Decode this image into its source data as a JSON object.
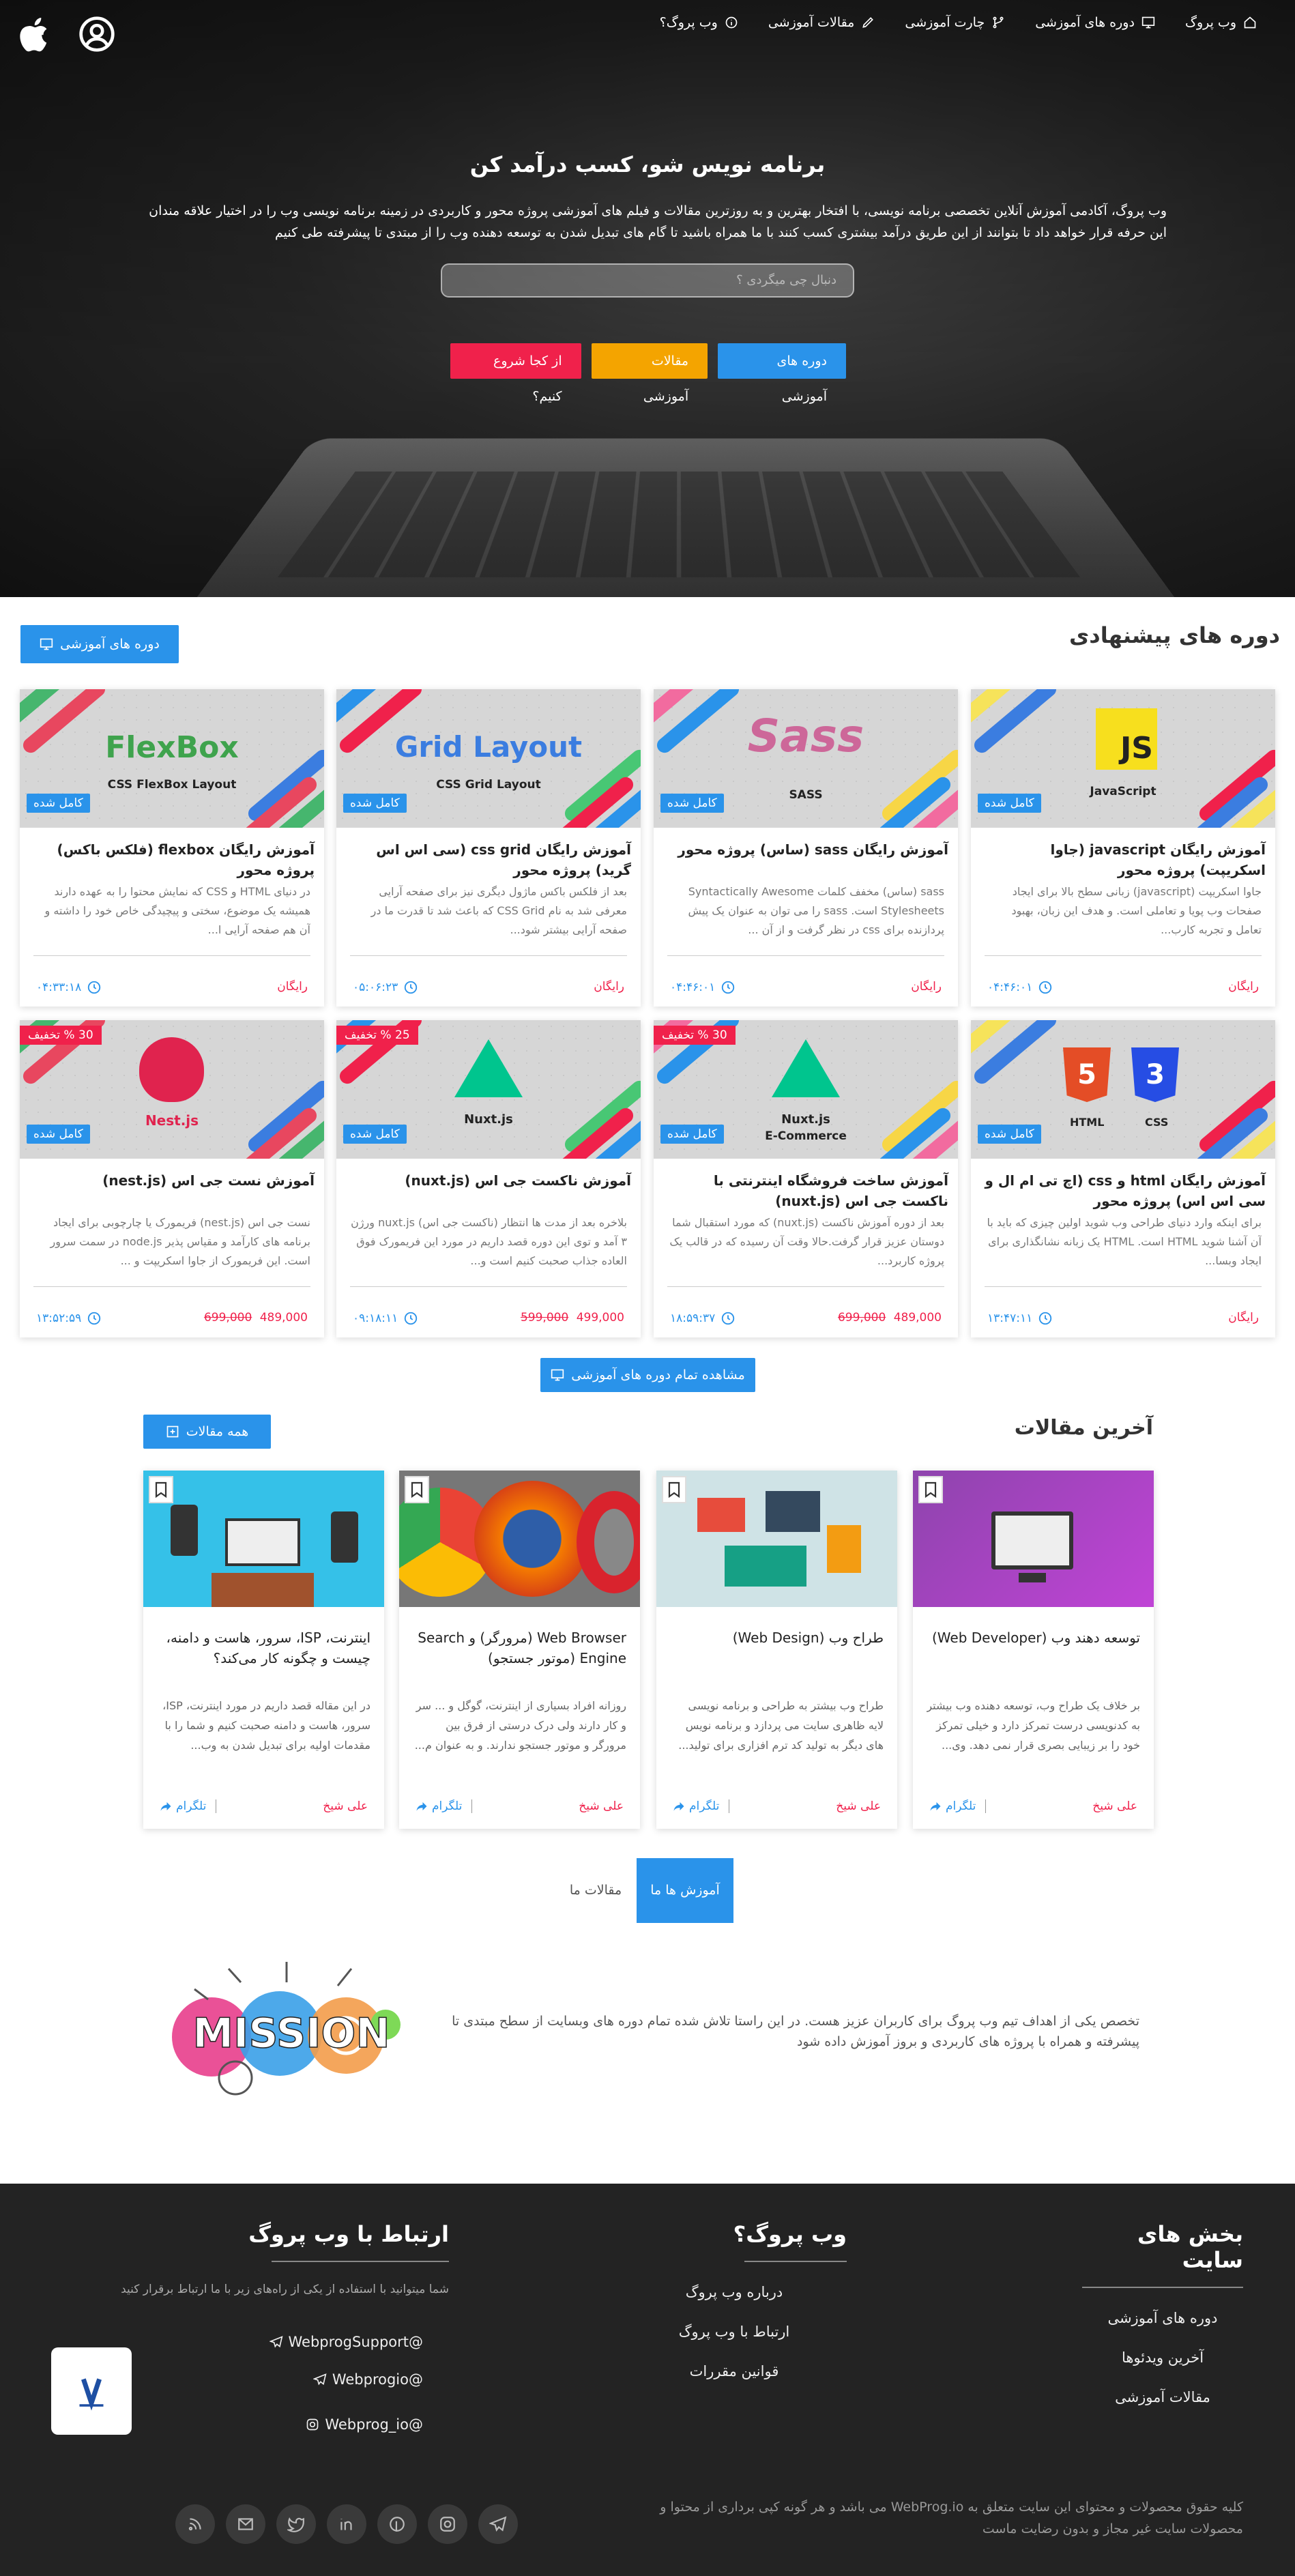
{
  "nav": {
    "items": [
      {
        "label": "وب پروگ",
        "icon": "home-icon"
      },
      {
        "label": "دوره های آموزشی",
        "icon": "monitor-icon"
      },
      {
        "label": "چارت آموزشی",
        "icon": "branch-icon"
      },
      {
        "label": "مقالات آموزشی",
        "icon": "pen-icon"
      },
      {
        "label": "وب پروگ؟",
        "icon": "info-icon"
      }
    ]
  },
  "hero": {
    "title": "برنامه نویس شو، کسب درآمد کن",
    "desc": "وب پروگ، آکادمی آموزش آنلاین تخصصی برنامه نویسی، با افتخار بهترین و به روزترین مقالات و فیلم های آموزشی پروژه محور و کاربردی در زمینه برنامه نویسی وب را در اختیار علاقه مندان این حرفه قرار خواهد داد تا بتوانند از این طریق درآمد بیشتری کسب کنند با ما همراه باشید تا گام های تبدیل شدن به توسعه دهنده وب را از مبتدی تا پیشرفته طی کنیم",
    "search_placeholder": "دنبال چی میگردی ؟",
    "btn_courses": "دوره های آموزشی",
    "btn_articles": "مقالات آموزشی",
    "btn_start": "از کجا شروع کنیم؟"
  },
  "courses": {
    "title": "دوره های پیشنهادی",
    "btn": "دوره های آموزشی",
    "done_label": "کامل شده",
    "free_label": "رایگان",
    "all_btn": "مشاهده تمام دوره های آموزشی",
    "items": [
      {
        "title": "آموزش رایگان javascript (جاوا اسکریپت) پروژه محور",
        "text": "جاوا اسکریپت (javascript) زبانی سطح بالا برای ایجاد صفحات وب پویا و تعاملی است. و هدف این زبان، بهبود تعامل و تجربه کارب...",
        "time": "۰۴:۴۶:۰۱",
        "logo": "JS",
        "sub": "JavaScript",
        "price": "رایگان",
        "old": "",
        "off": ""
      },
      {
        "title": "آموزش رایگان sass (ساس) پروژه محور",
        "text": "sass (ساس) مخفف کلمات Syntactically Awesome Stylesheets است. sass را می توان به عنوان یک پیش پردازنده برای css در نظر گرفت و از آن ...",
        "time": "۰۴:۴۶:۰۱",
        "logo": "Sass",
        "sub": "SASS",
        "price": "رایگان",
        "old": "",
        "off": ""
      },
      {
        "title": "آموزش رایگان css grid (سی اس اس گرید) پروژه محور",
        "text": "بعد از فلکس باکس ماژول دیگری نیز برای صفحه آرایی معرفی شد به نام CSS Grid که باعث شد تا قدرت ما در صفحه آرایی بیشتر شود...",
        "time": "۰۵:۰۶:۲۳",
        "logo": "Grid Layout",
        "sub": "CSS Grid Layout",
        "price": "رایگان",
        "old": "",
        "off": ""
      },
      {
        "title": "آموزش رایگان flexbox (فلکس باکس) پروژه محور",
        "text": "در دنیای HTML و CSS که نمایش محتوا را به عهده دارند همیشه یک موضوع، سختی و پیچیدگی خاص خود را داشته و آن هم صفحه آرایی ا...",
        "time": "۰۴:۳۳:۱۸",
        "logo": "FlexBox",
        "sub": "CSS FlexBox Layout",
        "price": "رایگان",
        "old": "",
        "off": ""
      },
      {
        "title": "آموزش رایگان html و css (اچ تی ام ال و سی اس اس) پروژه محور",
        "text": "برای اینکه وارد دنیای طراحی وب شوید اولین چیزی که باید با آن آشنا شوید HTML است. HTML یک زبانه نشانگذاری برای ایجاد وبسا...",
        "time": "۱۳:۴۷:۱۱",
        "logo": "HTML CSS",
        "sub": "",
        "price": "رایگان",
        "old": "",
        "off": ""
      },
      {
        "title": "آموزش ساخت فروشگاه اینترنتی با ناکست جی اس (nuxt.js)",
        "text": "بعد از دوره آموزش ناکست (nuxt.js) که مورد استقبال شما دوستان عزیز قرار گرفت.حالا وقت آن رسیده که در قالب یک پروژه کاربرد...",
        "time": "۱۸:۵۹:۳۷",
        "logo": "Nuxt.js",
        "sub": "E-Commerce",
        "price": "489,000",
        "old": "699,000",
        "off": "30 % تخفیف"
      },
      {
        "title": "آموزش ناکست جی اس (nuxt.js)",
        "text": "بلاخره بعد از مدت ها انتظار (ناکست جی اس) nuxt.js ورژن ۳ آمد و توی این دوره قصد داریم در مورد این فریمورک فوق العاده جذاب صحبت کنیم است و...",
        "time": "۰۹:۱۸:۱۱",
        "logo": "Nuxt.js",
        "sub": "",
        "price": "499,000",
        "old": "599,000",
        "off": "25 % تخفیف"
      },
      {
        "title": "آموزش نست جی اس (nest.js)",
        "text": "نست جی اس (nest.js) فریمورک یا چارچوبی برای ایجاد برنامه های کارآمد و مقیاس پذیر node.js در سمت سرور است. این فریمورک از جاوا اسکریپت و ...",
        "time": "۱۳:۵۲:۵۹",
        "logo": "Nest.js",
        "sub": "",
        "price": "489,000",
        "old": "699,000",
        "off": "30 % تخفیف"
      }
    ]
  },
  "articles": {
    "title": "آخرین مقالات",
    "btn": "همه مقالات",
    "telegram": "تلگرام",
    "items": [
      {
        "title": "توسعه دهند وب (Web Developer)",
        "text": "بر خلاف یک طراح وب، توسعه دهنده وب بیشتر به کدنویسی درست تمرکز دارد و خیلی تمرکز خود را بر زیبایی بصری قرار نمی دهد. وی...",
        "author": "علی شیخ"
      },
      {
        "title": "طراح وب (Web Design)",
        "text": "طراح وب بیشتر به طراحی و برنامه نویسی لایه ظاهری سایت می پردازد و برنامه نویس های دیگر به تولید کد ترم افزاری برای تولید...",
        "author": "علی شیخ"
      },
      {
        "title": "Web Browser (مرورگر) و Search Engine (موتور جستجو)",
        "text": "روزانه افراد بسیاری از اینترنت، گوگل و ... سر و کار دارند ولی درک درستی از فرق بین مرورگر و موتور جستجو ندارند. و به عنوان م...",
        "author": "علی شیخ"
      },
      {
        "title": "اینترنت، ISP، سرور، هاست و دامنه، چیست و چگونه کار می‌کند؟",
        "text": "در این مقاله قصد داریم در مورد اینترنت، ISP، سرور، هاست و دامنه صحبت کنیم و شما را با مقدمات اولیه برای تبدیل شدن به وب...",
        "author": "علی شیخ"
      }
    ]
  },
  "tabs": {
    "active": "آموزش ها ما",
    "other": "مقالات ما"
  },
  "mission": {
    "word": "MISSION",
    "text": "تخصص یکی از اهداف تیم وب پروگ برای کاربران عزیز هست. در این راستا تلاش شده تمام دوره های وبسایت از سطح مبتدی تا پیشرفته و همراه با پروژه های کاربردی و بروز آموزش داده شود"
  },
  "footer": {
    "col1": {
      "title": "بخش های سایت",
      "links": [
        "دوره های آموزشی",
        "آخرین ویدئوها",
        "مقالات آموزشی"
      ]
    },
    "col2": {
      "title": "وب پروگ؟",
      "links": [
        "درباره وب پروگ",
        "ارتباط با وب پروگ",
        "قوانین مقررات"
      ]
    },
    "col3": {
      "title": "ارتباط با وب پروگ",
      "desc": "شما میتوانید با استفاده از یکی از راه‌های زیر با ما ارتباط برقرار کنید",
      "links": [
        "WebprogSupport@",
        "Webprogio@",
        "Webprog_io@"
      ]
    },
    "copyright": "کلیه حقوق محصولات و محتوای این سایت متعلق به WebProg.io می باشد و هر گونه کپی برداری از محتوا و محصولات سایت غیر مجاز و بدون رضایت ماست"
  },
  "colors": {
    "accent": "#2a93ea",
    "red": "#f0214b",
    "yellow": "#f4a400",
    "footer": "#232323"
  }
}
